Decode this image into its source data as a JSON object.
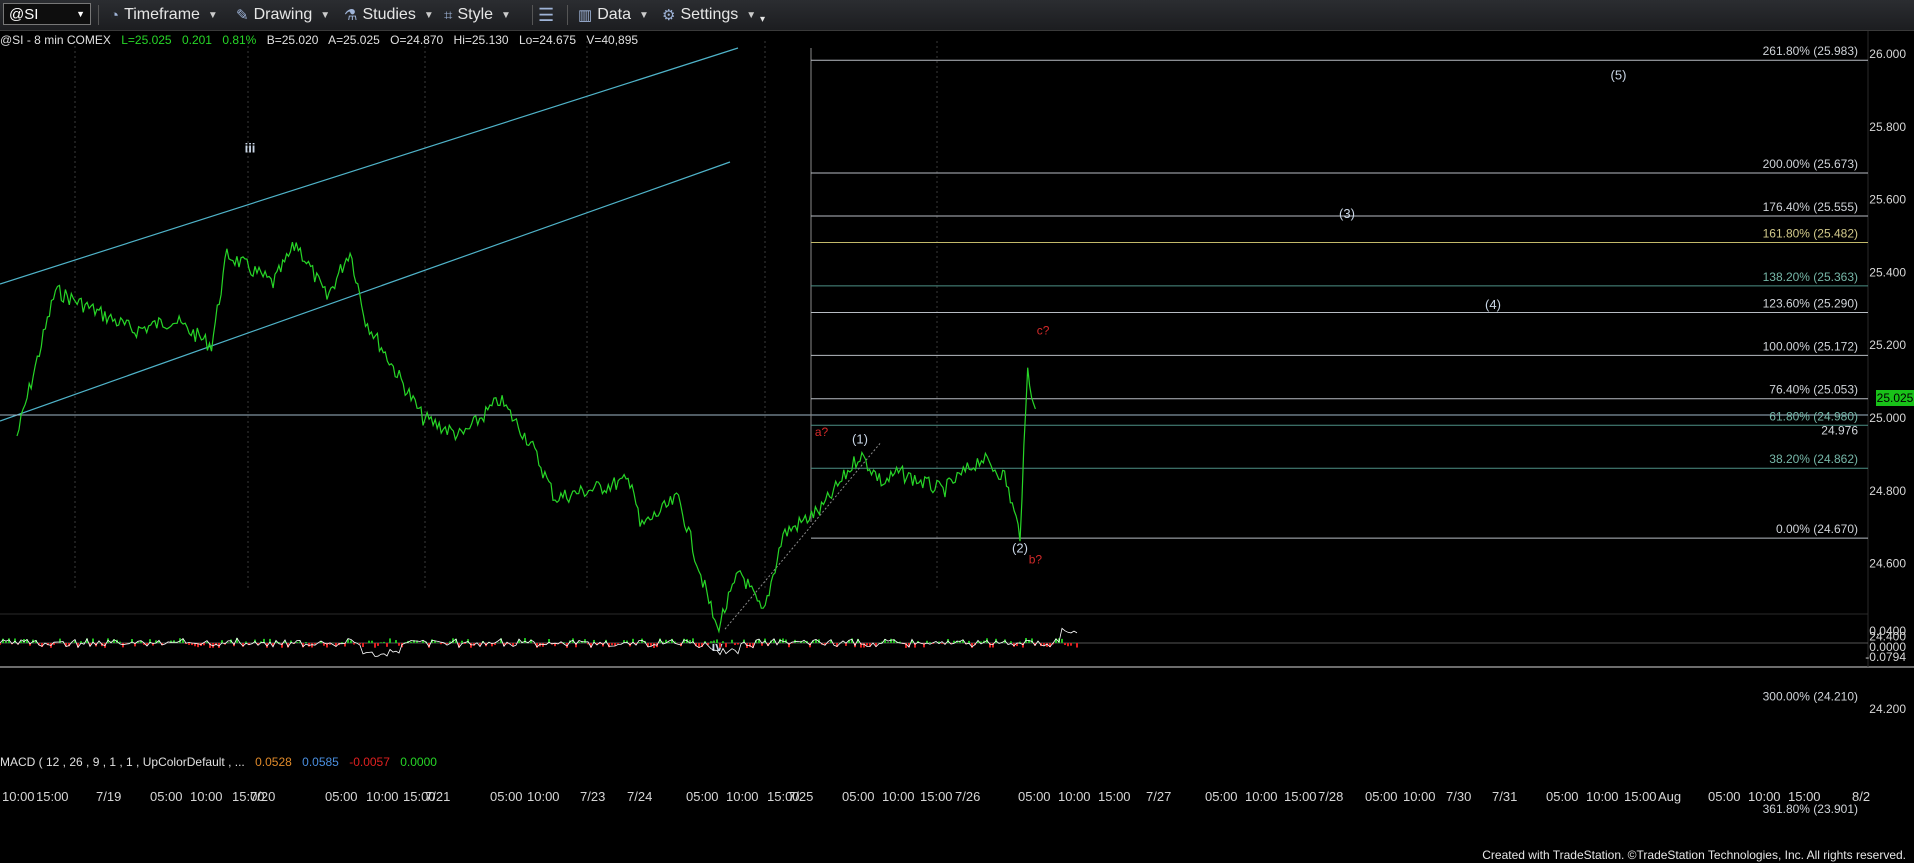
{
  "toolbar": {
    "symbol": "@SI",
    "timeframe": "Timeframe",
    "drawing": "Drawing",
    "studies": "Studies",
    "style": "Style",
    "data": "Data",
    "settings": "Settings"
  },
  "info": {
    "symbol_line": "@SI - 8 min  COMEX",
    "last": "L=25.025",
    "change": "0.201",
    "pct": "0.81%",
    "bid": "B=25.020",
    "ask": "A=25.025",
    "open": "O=24.870",
    "high": "Hi=25.130",
    "low": "Lo=24.675",
    "volume": "V=40,895"
  },
  "macd": {
    "label": "MACD ( 12 , 26 , 9 , 1 , 1 , UpColorDefault , ...",
    "v1": "0.0528",
    "v2": "0.0585",
    "v3": "-0.0057",
    "v4": "0.0000"
  },
  "last_price_tag": "25.025",
  "footer": "Created with TradeStation. ©TradeStation Technologies, Inc. All rights reserved.",
  "colors": {
    "price": "#27d627",
    "channel": "#4fb3c9",
    "fib": "#b7bcc3",
    "fib_gold": "#c2b96a",
    "fib_teal": "#4d8f86",
    "wave_label": "#c9d6e6",
    "red_label": "#d42a2a",
    "macd_signal": "#ffffff",
    "macd_up": "#1fbf1f",
    "macd_down": "#e02020"
  },
  "chart_data": {
    "type": "line",
    "title": "@SI - 8 min COMEX",
    "ylim": [
      24.0,
      26.05
    ],
    "y_ticks": [
      "26.000",
      "25.800",
      "25.600",
      "25.400",
      "25.200",
      "25.000",
      "24.800",
      "24.600",
      "24.400",
      "24.200"
    ],
    "x_ticks": [
      "10:00",
      "15:00",
      "7/19",
      "05:00",
      "10:00",
      "15:00",
      "7/20",
      "05:00",
      "10:00",
      "15:00",
      "7/21",
      "05:00",
      "10:00",
      "7/23",
      "7/24",
      "05:00",
      "10:00",
      "15:00",
      "7/25",
      "05:00",
      "10:00",
      "15:00",
      "7/26",
      "05:00",
      "10:00",
      "15:00",
      "7/27",
      "05:00",
      "10:00",
      "15:00",
      "7/28",
      "05:00",
      "10:00",
      "7/30",
      "7/31",
      "05:00",
      "10:00",
      "15:00",
      "Aug",
      "05:00",
      "10:00",
      "15:00",
      "8/2"
    ],
    "series": [
      {
        "values": [
          {
            "x": "7/18 10:00",
            "y": 24.95
          },
          {
            "x": "7/18 15:00",
            "y": 25.35
          },
          {
            "x": "7/19 05:00",
            "y": 25.24
          },
          {
            "x": "7/19 10:00",
            "y": 25.27
          },
          {
            "x": "7/19 15:00",
            "y": 25.2
          },
          {
            "x": "7/19 17:00",
            "y": 25.45
          },
          {
            "x": "7/20 03:00",
            "y": 25.37
          },
          {
            "x": "7/20 06:00",
            "y": 25.48
          },
          {
            "x": "7/20 10:00",
            "y": 25.33
          },
          {
            "x": "7/20 13:00",
            "y": 25.46
          },
          {
            "x": "7/20 15:00",
            "y": 25.27
          },
          {
            "x": "7/21 00:00",
            "y": 25.0
          },
          {
            "x": "7/21 05:00",
            "y": 24.95
          },
          {
            "x": "7/21 10:00",
            "y": 25.05
          },
          {
            "x": "7/21 14:00",
            "y": 24.93
          },
          {
            "x": "7/23 00:00",
            "y": 24.78
          },
          {
            "x": "7/23 10:00",
            "y": 24.83
          },
          {
            "x": "7/24 00:00",
            "y": 24.7
          },
          {
            "x": "7/24 05:00",
            "y": 24.78
          },
          {
            "x": "7/24 10:00",
            "y": 24.42
          },
          {
            "x": "7/24 13:00",
            "y": 24.58
          },
          {
            "x": "7/24 16:00",
            "y": 24.46
          },
          {
            "x": "7/25 00:00",
            "y": 24.68
          },
          {
            "x": "7/25 05:00",
            "y": 24.75
          },
          {
            "x": "7/25 10:00",
            "y": 24.9
          },
          {
            "x": "7/25 13:00",
            "y": 24.82
          },
          {
            "x": "7/25 15:00",
            "y": 24.85
          },
          {
            "x": "7/26 00:00",
            "y": 24.8
          },
          {
            "x": "7/26 05:00",
            "y": 24.89
          },
          {
            "x": "7/26 08:00",
            "y": 24.84
          },
          {
            "x": "7/26 10:00",
            "y": 24.68
          },
          {
            "x": "7/26 11:00",
            "y": 25.13
          },
          {
            "x": "7/26 12:00",
            "y": 25.025
          }
        ]
      }
    ],
    "fib_levels": [
      {
        "label": "261.80% (25.983)",
        "value": 25.983
      },
      {
        "label": "200.00% (25.673)",
        "value": 25.673
      },
      {
        "label": "176.40% (25.555)",
        "value": 25.555
      },
      {
        "label": "161.80% (25.482)",
        "value": 25.482
      },
      {
        "label": "138.20% (25.363)",
        "value": 25.363
      },
      {
        "label": "123.60% (25.290)",
        "value": 25.29
      },
      {
        "label": "100.00% (25.172)",
        "value": 25.172
      },
      {
        "label": "76.40% (25.053)",
        "value": 25.053
      },
      {
        "label": "61.80% (24.980)",
        "value": 24.98
      },
      {
        "label": "38.20% (24.862)",
        "value": 24.862
      },
      {
        "label": "0.00% (24.670)",
        "value": 24.67
      },
      {
        "label": "300.00% (24.210)",
        "value": 24.21
      },
      {
        "label": "361.80% (23.901)",
        "value": 23.901
      }
    ],
    "extra_price_label": "24.976",
    "wave_labels": [
      {
        "text": "iii",
        "x": "7/20 00:00",
        "y": 25.73
      },
      {
        "text": "iv",
        "x": "7/24 10:00",
        "y": 24.36
      },
      {
        "text": "(1)",
        "x": "7/25 10:00",
        "y": 24.93
      },
      {
        "text": "(2)",
        "x": "7/26 10:00",
        "y": 24.63
      },
      {
        "text": "(3)",
        "x": "7/28 10:00",
        "y": 25.55
      },
      {
        "text": "(4)",
        "x": "7/30 10:00",
        "y": 25.3
      },
      {
        "text": "(5)",
        "x": "Aug 05:00",
        "y": 25.93
      }
    ],
    "red_labels": [
      {
        "text": "a?",
        "x": "7/25 05:00",
        "y": 24.95
      },
      {
        "text": "b?",
        "x": "7/26 12:00",
        "y": 24.6
      },
      {
        "text": "c?",
        "x": "7/26 13:00",
        "y": 25.23
      }
    ],
    "macd_scale": [
      "0.0400",
      "0.0000",
      "-0.0794"
    ]
  }
}
